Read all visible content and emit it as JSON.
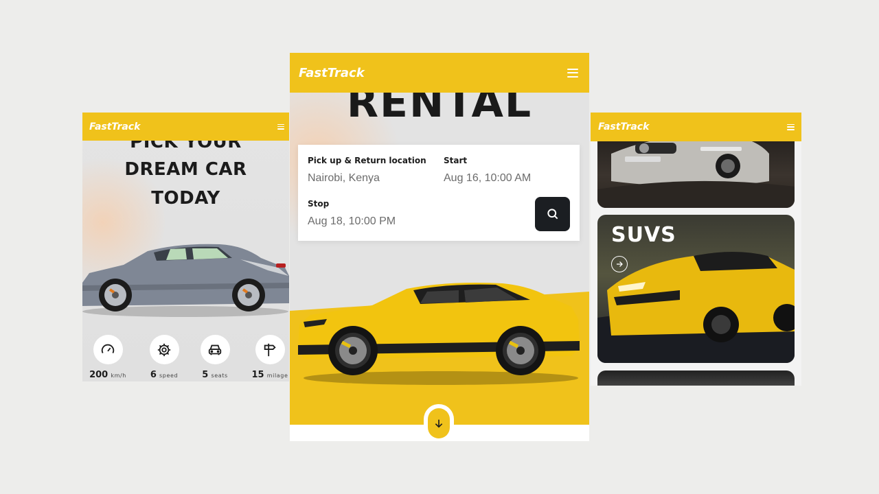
{
  "brand": {
    "logo_text": "FastTrack",
    "accent": "#f0c21b",
    "dark": "#1b1e22"
  },
  "left_screen": {
    "headline": [
      "PICK YOUR",
      "DREAM CAR",
      "TODAY"
    ],
    "specs": [
      {
        "icon": "speedometer-icon",
        "value": "200",
        "unit": "km/h"
      },
      {
        "icon": "gear-icon",
        "value": "6",
        "unit": "speed"
      },
      {
        "icon": "car-icon",
        "value": "5",
        "unit": "seats"
      },
      {
        "icon": "signpost-icon",
        "value": "15",
        "unit": "milage"
      }
    ]
  },
  "middle_screen": {
    "hero_word": "RENTAL",
    "booking": {
      "location_label": "Pick up & Return location",
      "location_value": "Nairobi, Kenya",
      "start_label": "Start",
      "start_value": "Aug 16, 10:00 AM",
      "stop_label": "Stop",
      "stop_value": "Aug 18, 10:00 PM",
      "search_icon": "search-icon"
    },
    "scroll_icon": "arrow-down-icon"
  },
  "right_screen": {
    "cards": [
      {
        "title": ""
      },
      {
        "title": "SUVS",
        "icon": "arrow-right-circle-icon"
      },
      {
        "title": ""
      }
    ]
  }
}
